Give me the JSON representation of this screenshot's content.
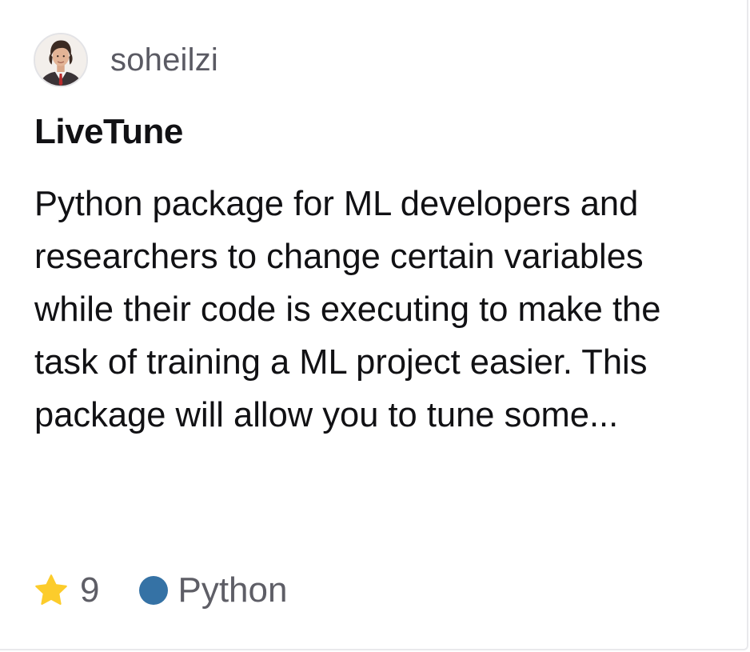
{
  "owner": {
    "name": "soheilzi",
    "avatar": "avatar-photo"
  },
  "repo": {
    "name": "LiveTune",
    "description": "Python package for ML developers and researchers to change certain variables while their code is executing to make the task of training a ML project easier. This package will allow you to tune some..."
  },
  "meta": {
    "star_icon": "star-icon",
    "stars": "9",
    "language": "Python",
    "star_color": "#fccc2b",
    "language_color": "#3572a5"
  }
}
